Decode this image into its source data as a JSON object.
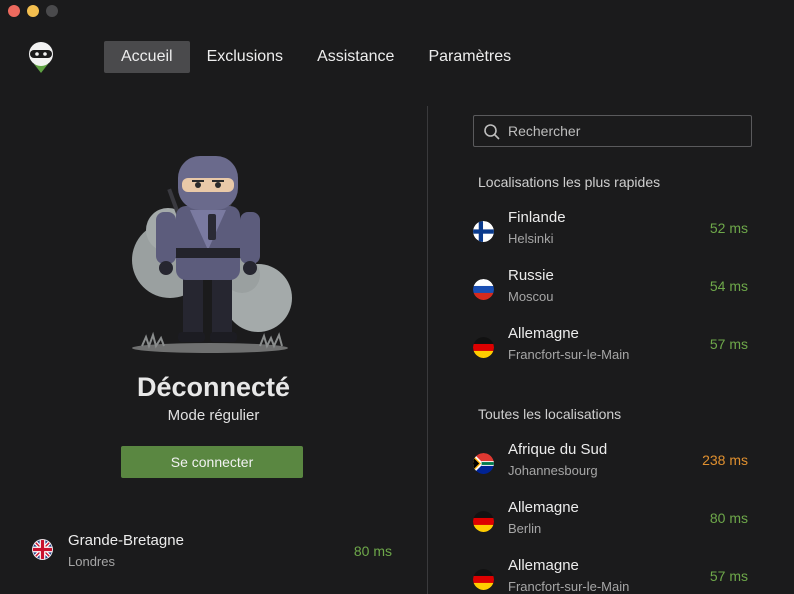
{
  "nav": {
    "items": [
      {
        "label": "Accueil",
        "active": true
      },
      {
        "label": "Exclusions",
        "active": false
      },
      {
        "label": "Assistance",
        "active": false
      },
      {
        "label": "Paramètres",
        "active": false
      }
    ]
  },
  "status": {
    "title": "Déconnecté",
    "mode": "Mode régulier",
    "connect_label": "Se connecter"
  },
  "current_location": {
    "country": "Grande-Bretagne",
    "city": "Londres",
    "ping": "80 ms",
    "flag": "gb-flag-icon"
  },
  "search": {
    "placeholder": "Rechercher"
  },
  "fastest": {
    "title": "Localisations les plus rapides",
    "items": [
      {
        "country": "Finlande",
        "city": "Helsinki",
        "ping": "52 ms",
        "flag": "fi-flag-icon"
      },
      {
        "country": "Russie",
        "city": "Moscou",
        "ping": "54 ms",
        "flag": "ru-flag-icon"
      },
      {
        "country": "Allemagne",
        "city": "Francfort-sur-le-Main",
        "ping": "57 ms",
        "flag": "de-flag-icon"
      }
    ]
  },
  "all": {
    "title": "Toutes les localisations",
    "items": [
      {
        "country": "Afrique du Sud",
        "city": "Johannesbourg",
        "ping": "238 ms",
        "flag": "za-flag-icon"
      },
      {
        "country": "Allemagne",
        "city": "Berlin",
        "ping": "80 ms",
        "flag": "de-flag-icon"
      },
      {
        "country": "Allemagne",
        "city": "Francfort-sur-le-Main",
        "ping": "57 ms",
        "flag": "de-flag-icon"
      }
    ]
  },
  "colors": {
    "ping_good": "#6ea84a",
    "ping_slow": "#e0902f",
    "connect_button": "#5a8741",
    "background": "#1b1b1c",
    "nav_active": "#4a4a4c"
  }
}
